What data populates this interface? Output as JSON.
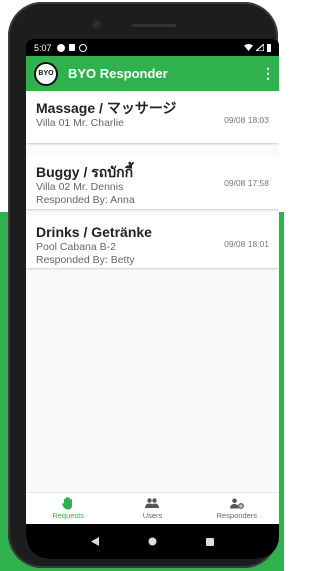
{
  "status_bar": {
    "time": "5:07"
  },
  "app_bar": {
    "logo_text": "BYO",
    "title": "BYO Responder"
  },
  "requests": [
    {
      "title": "Massage / マッサージ",
      "location": "Villa 01 Mr. Charlie",
      "responded_by": "",
      "time": "09/08 18:03"
    },
    {
      "title": "Buggy / รถบักกี้",
      "location": "Villa 02 Mr. Dennis",
      "responded_by": "Responded By: Anna",
      "time": "09/08 17:58"
    },
    {
      "title": "Drinks / Getränke",
      "location": "Pool Cabana B-2",
      "responded_by": "Responded By: Betty",
      "time": "09/08 18:01"
    }
  ],
  "bottom_nav": {
    "items": [
      {
        "label": "Requests",
        "icon": "hand-icon",
        "active": true
      },
      {
        "label": "Users",
        "icon": "users-icon",
        "active": false
      },
      {
        "label": "Responders",
        "icon": "responder-settings-icon",
        "active": false
      }
    ]
  },
  "colors": {
    "accent": "#2fb14e",
    "accent_background": "#2fb14e"
  }
}
